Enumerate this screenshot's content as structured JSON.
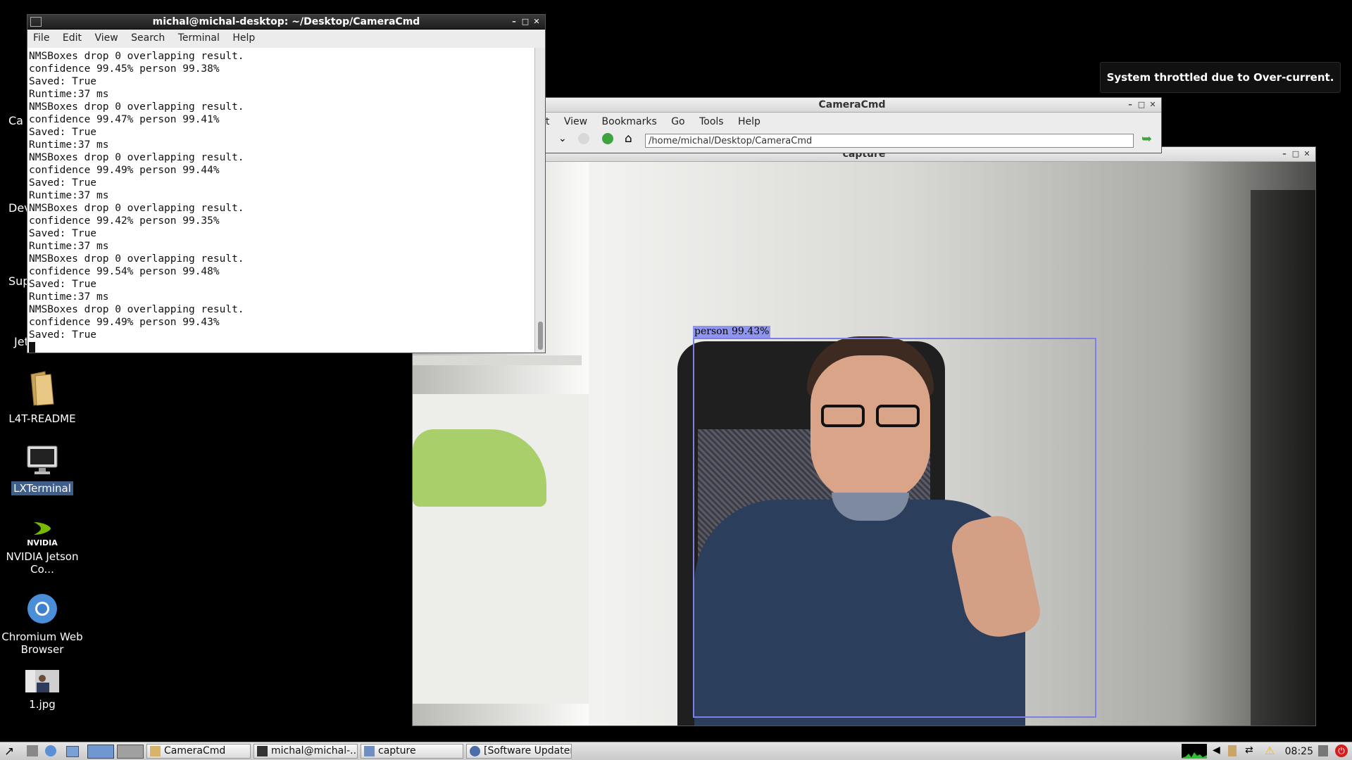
{
  "desktop": {
    "partial_labels": [
      "Ca",
      "Dev",
      "Sup",
      "Jet"
    ],
    "icons": [
      {
        "label": "L4T-README",
        "icon": "folder-icon"
      },
      {
        "label": "LXTerminal",
        "icon": "monitor-icon"
      },
      {
        "label": "NVIDIA Jetson Co...",
        "brand": "NVIDIA",
        "icon": "nvidia-icon"
      },
      {
        "label": "Chromium Web Browser",
        "icon": "chromium-icon"
      },
      {
        "label": "1.jpg",
        "icon": "image-thumbnail-icon"
      }
    ]
  },
  "terminal": {
    "title": "michal@michal-desktop: ~/Desktop/CameraCmd",
    "menu": [
      "File",
      "Edit",
      "View",
      "Search",
      "Terminal",
      "Help"
    ],
    "lines": [
      "NMSBoxes drop 0 overlapping result.",
      "confidence 99.45% person 99.38%",
      "Saved: True",
      "Runtime:37 ms",
      "NMSBoxes drop 0 overlapping result.",
      "confidence 99.47% person 99.41%",
      "Saved: True",
      "Runtime:37 ms",
      "NMSBoxes drop 0 overlapping result.",
      "confidence 99.49% person 99.44%",
      "Saved: True",
      "Runtime:37 ms",
      "NMSBoxes drop 0 overlapping result.",
      "confidence 99.42% person 99.35%",
      "Saved: True",
      "Runtime:37 ms",
      "NMSBoxes drop 0 overlapping result.",
      "confidence 99.54% person 99.48%",
      "Saved: True",
      "Runtime:37 ms",
      "NMSBoxes drop 0 overlapping result.",
      "confidence 99.49% person 99.43%",
      "Saved: True"
    ]
  },
  "filemanager": {
    "title": "CameraCmd",
    "menu": [
      "it",
      "View",
      "Bookmarks",
      "Go",
      "Tools",
      "Help"
    ],
    "path": "/home/michal/Desktop/CameraCmd"
  },
  "capture": {
    "title": "capture",
    "detection_label": "person 99.43%"
  },
  "notification": {
    "text": "System throttled due to Over-current."
  },
  "taskbar": {
    "tasks": [
      "CameraCmd",
      "michal@michal-...",
      "capture",
      "[Software Updater]"
    ],
    "clock": "08:25"
  },
  "colors": {
    "bbox": "#7b7fe6",
    "warning": "#f5b800",
    "power": "#d21e1e",
    "nvidia_green": "#76b900"
  }
}
